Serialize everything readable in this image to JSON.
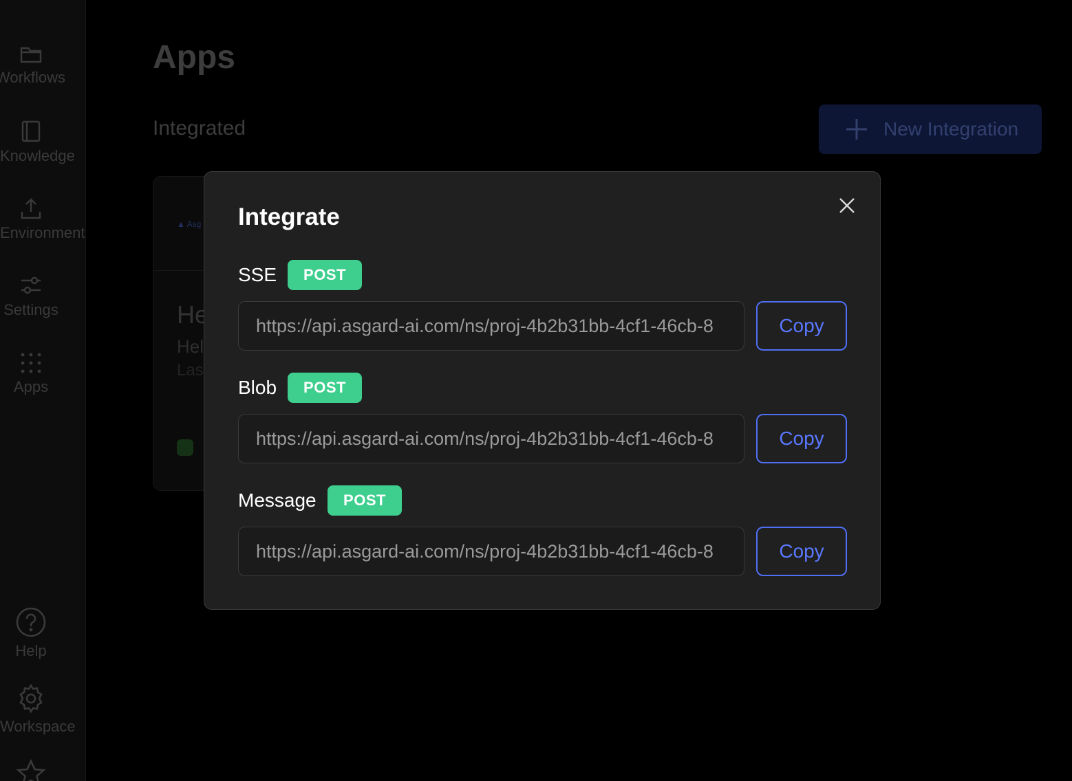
{
  "sidebar": {
    "items": [
      {
        "label": "Workflows",
        "icon": "folder-icon"
      },
      {
        "label": "Knowledge",
        "icon": "book-icon"
      },
      {
        "label": "Environment",
        "icon": "upload-icon"
      },
      {
        "label": "Settings",
        "icon": "sliders-icon"
      },
      {
        "label": "Apps",
        "icon": "grid-icon"
      }
    ],
    "bottom_items": [
      {
        "label": "Help",
        "icon": "help-circle-icon"
      },
      {
        "label": "Workspace",
        "icon": "gear-icon"
      }
    ]
  },
  "main": {
    "title": "Apps",
    "section_title": "Integrated",
    "new_button_label": "New Integration",
    "card": {
      "logo_text": "Asg",
      "title": "He",
      "subtitle": "Hel",
      "meta": "Las"
    }
  },
  "modal": {
    "title": "Integrate",
    "endpoints": [
      {
        "label": "SSE",
        "method": "POST",
        "url": "https://api.asgard-ai.com/ns/proj-4b2b31bb-4cf1-46cb-8",
        "copy_label": "Copy"
      },
      {
        "label": "Blob",
        "method": "POST",
        "url": "https://api.asgard-ai.com/ns/proj-4b2b31bb-4cf1-46cb-8",
        "copy_label": "Copy"
      },
      {
        "label": "Message",
        "method": "POST",
        "url": "https://api.asgard-ai.com/ns/proj-4b2b31bb-4cf1-46cb-8",
        "copy_label": "Copy"
      }
    ]
  },
  "colors": {
    "accent": "#4f6ff5",
    "post_badge": "#3ecf8e",
    "modal_bg": "#202020",
    "backdrop": "#000000"
  }
}
